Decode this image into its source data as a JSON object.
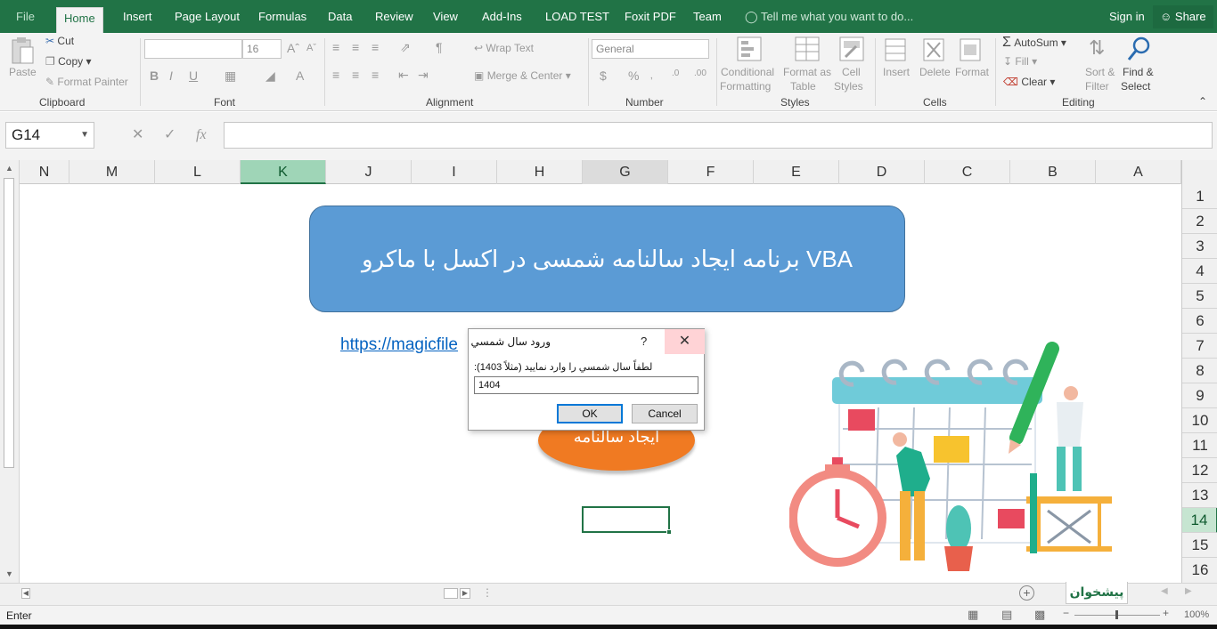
{
  "tabs": [
    "File",
    "Home",
    "Insert",
    "Page Layout",
    "Formulas",
    "Data",
    "Review",
    "View",
    "Add-Ins",
    "LOAD TEST",
    "Foxit PDF",
    "Team"
  ],
  "tell_me": "Tell me what you want to do...",
  "sign_in": "Sign in",
  "share": "Share",
  "clipboard": {
    "paste": "Paste",
    "cut": "Cut",
    "copy": "Copy",
    "format_painter": "Format Painter",
    "label": "Clipboard"
  },
  "font": {
    "name": "",
    "size": "16",
    "label": "Font"
  },
  "alignment": {
    "wrap_text": "Wrap Text",
    "merge_center": "Merge & Center",
    "label": "Alignment"
  },
  "number": {
    "format": "General",
    "label": "Number"
  },
  "styles": {
    "conditional": "Conditional",
    "formatting": "Formatting",
    "format_as": "Format as",
    "table": "Table",
    "cell": "Cell",
    "cell_styles": "Styles",
    "label": "Styles"
  },
  "cells": {
    "insert": "Insert",
    "delete": "Delete",
    "format": "Format",
    "label": "Cells"
  },
  "editing": {
    "autosum": "AutoSum",
    "fill": "Fill",
    "clear": "Clear",
    "sort": "Sort &",
    "filter": "Filter",
    "find": "Find &",
    "select": "Select",
    "label": "Editing"
  },
  "name_box": "G14",
  "fx_label": "fx",
  "formula": "",
  "columns": [
    "N",
    "M",
    "L",
    "K",
    "J",
    "I",
    "H",
    "G",
    "F",
    "E",
    "D",
    "C",
    "B",
    "A"
  ],
  "selected_column": "K",
  "rows": [
    "1",
    "2",
    "3",
    "4",
    "5",
    "6",
    "7",
    "8",
    "9",
    "10",
    "11",
    "12",
    "13",
    "14",
    "15",
    "16"
  ],
  "selected_row": "14",
  "sheet": {
    "title_shape": "برنامه ایجاد سالنامه شمسی در اکسل با ماکرو VBA",
    "link": "https://magicfile",
    "button_shape": "ایجاد سالنامه"
  },
  "sheet_tab": "پیشخوان",
  "status": "Enter",
  "zoom": "100%",
  "dialog": {
    "title": "ورود سال شمسي",
    "help": "?",
    "prompt": "لطفاً سال شمسي را وارد نماييد (مثلاً 1403):",
    "value": "1404",
    "ok": "OK",
    "cancel": "Cancel"
  }
}
